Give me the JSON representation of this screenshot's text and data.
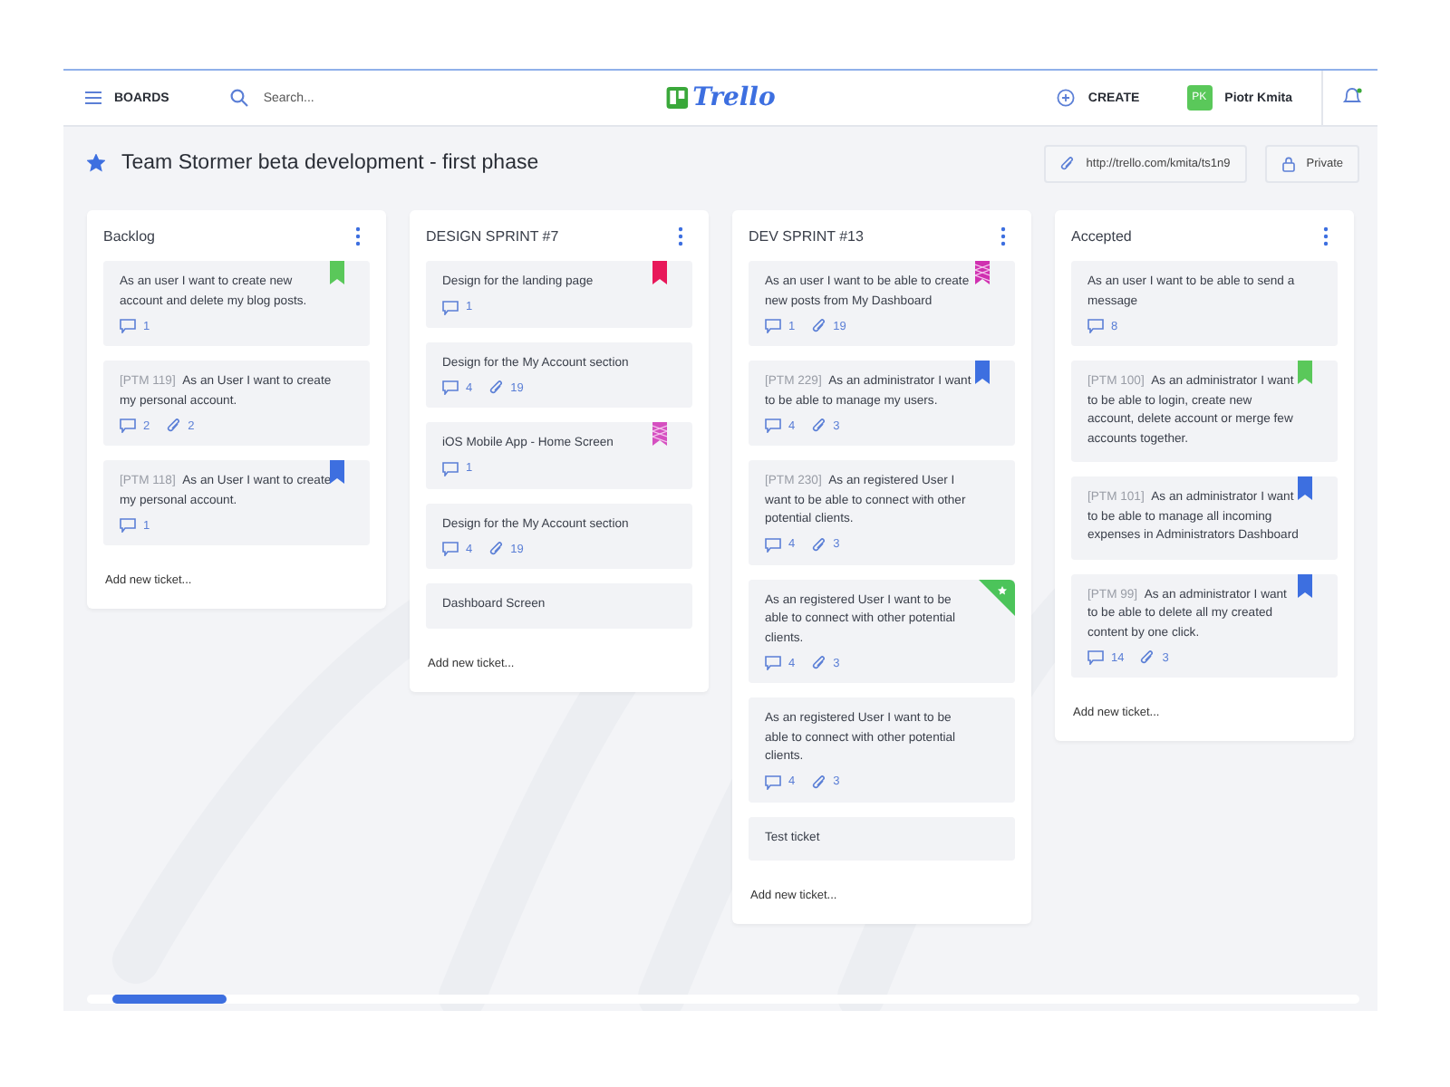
{
  "header": {
    "boards_label": "BOARDS",
    "search": {
      "placeholder": "Search..."
    },
    "logo_text": "Trello",
    "create_label": "CREATE",
    "user": {
      "initials": "PK",
      "name": "Piotr Kmita"
    }
  },
  "board": {
    "title": "Team Stormer beta development - first phase",
    "starred": true,
    "link": "http://trello.com/kmita/ts1n9",
    "visibility": "Private"
  },
  "lists": [
    {
      "title": "Backlog",
      "add_label": "Add new ticket...",
      "cards": [
        {
          "text": "As an user I want to create new account and delete my blog posts.",
          "comments": "1",
          "label": {
            "kind": "ribbon",
            "color": "#5ac85a"
          }
        },
        {
          "code": "[PTM 119]",
          "text": "As an User I want to create my personal account.",
          "comments": "2",
          "attachments": "2"
        },
        {
          "code": "[PTM 118]",
          "text": "As an User I want to create my personal account.",
          "comments": "1",
          "label": {
            "kind": "ribbon",
            "color": "#3d6fe0"
          }
        }
      ]
    },
    {
      "title": "DESIGN SPRINT #7",
      "add_label": "Add new ticket...",
      "cards": [
        {
          "text": "Design for the landing page",
          "comments": "1",
          "label": {
            "kind": "ribbon",
            "color": "#e8185a"
          }
        },
        {
          "text": "Design for the My Account section",
          "comments": "4",
          "attachments": "19"
        },
        {
          "text": "iOS Mobile App - Home Screen",
          "comments": "1",
          "label": {
            "kind": "patterned",
            "color": "#d54fc0"
          }
        },
        {
          "text": "Design for the My Account section",
          "comments": "4",
          "attachments": "19"
        },
        {
          "text": "Dashboard Screen"
        }
      ]
    },
    {
      "title": "DEV SPRINT #13",
      "add_label": "Add new ticket...",
      "cards": [
        {
          "text": "As an user I want to be able to create new posts from My Dashboard",
          "comments": "1",
          "attachments": "19",
          "label": {
            "kind": "patterned",
            "color": "#d030b0"
          }
        },
        {
          "code": "[PTM 229]",
          "text": "As an administrator I want to be able to manage my users.",
          "comments": "4",
          "attachments": "3",
          "label": {
            "kind": "ribbon",
            "color": "#3d6fe0"
          }
        },
        {
          "code": "[PTM 230]",
          "text": "As an registered User I want to be able to connect with other potential clients.",
          "comments": "4",
          "attachments": "3"
        },
        {
          "text": "As an registered User I want to be able to connect with other potential clients.",
          "comments": "4",
          "attachments": "3",
          "label": {
            "kind": "corner",
            "color": "#4cc45a"
          }
        },
        {
          "text": "As an registered User I want to be able to connect with other potential clients.",
          "comments": "4",
          "attachments": "3"
        },
        {
          "text": "Test ticket"
        }
      ]
    },
    {
      "title": "Accepted",
      "add_label": "Add new ticket...",
      "cards": [
        {
          "text": "As an user I want to be able to send a message",
          "comments": "8"
        },
        {
          "code": "[PTM 100]",
          "text": "As an administrator I want to be able to login, create new account, delete account or merge few accounts together.",
          "label": {
            "kind": "ribbon",
            "color": "#5ac85a"
          }
        },
        {
          "code": "[PTM 101]",
          "text": "As an administrator I want to be able to manage all incoming expenses in Administrators Dashboard",
          "label": {
            "kind": "ribbon",
            "color": "#3d6fe0"
          }
        },
        {
          "code": "[PTM 99]",
          "text": "As an administrator I want to be able to delete all my created content by one click.",
          "comments": "14",
          "attachments": "3",
          "label": {
            "kind": "ribbon",
            "color": "#3d6fe0"
          }
        }
      ]
    }
  ],
  "scrollbar": {
    "level": 0.09
  }
}
